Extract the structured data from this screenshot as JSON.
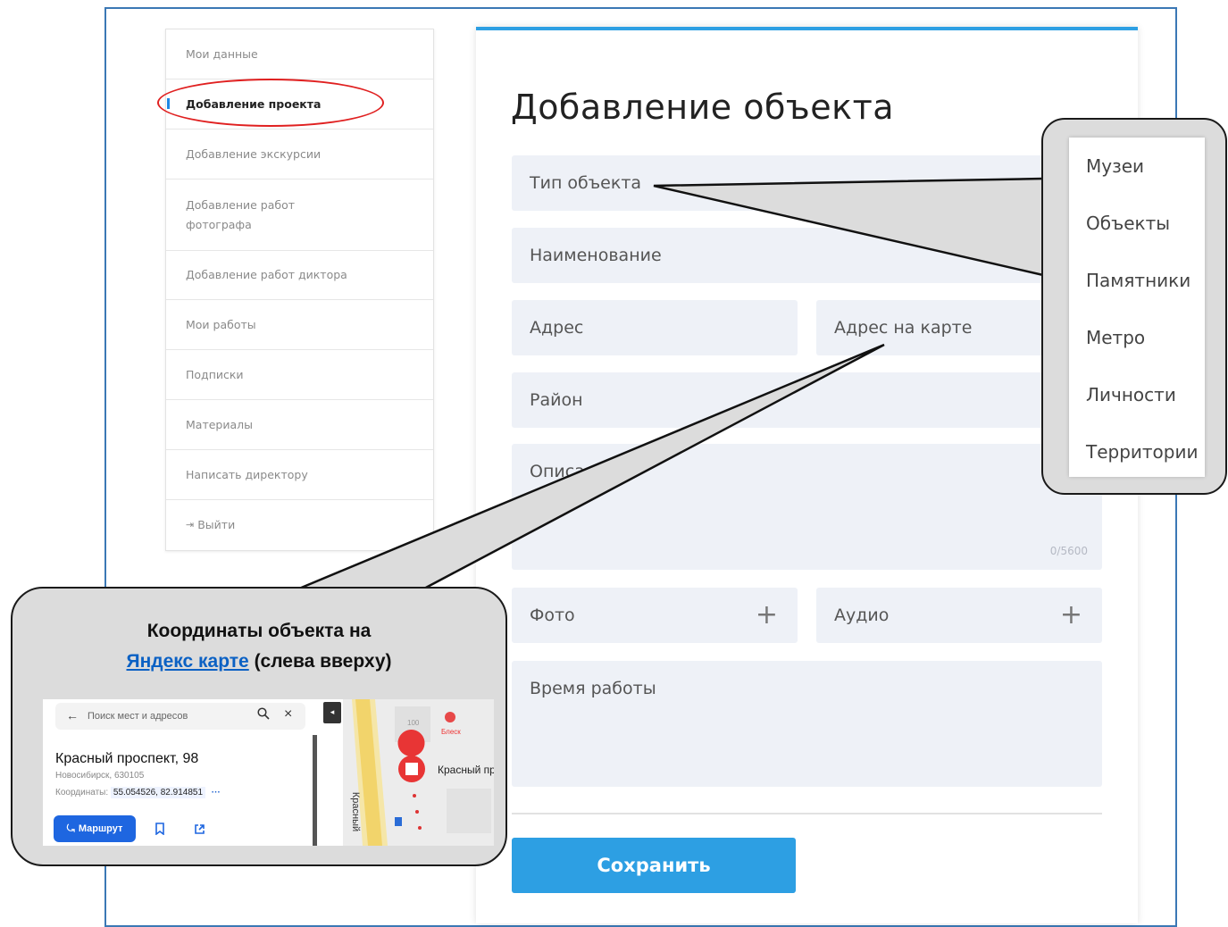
{
  "sidebar": {
    "items": [
      {
        "label": "Мои данные"
      },
      {
        "label": "Добавление проекта"
      },
      {
        "label": "Добавление экскурсии"
      },
      {
        "label": "Добавление работ фотографа"
      },
      {
        "label": "Добавление работ диктора"
      },
      {
        "label": "Мои работы"
      },
      {
        "label": "Подписки"
      },
      {
        "label": "Материалы"
      },
      {
        "label": "Написать директору"
      },
      {
        "label": "Выйти"
      }
    ]
  },
  "form": {
    "title": "Добавление объекта",
    "type_label": "Тип объекта",
    "name_label": "Наименование",
    "address_label": "Адрес",
    "map_address_label": "Адрес на карте",
    "district_label": "Район",
    "description_label": "Описание",
    "description_counter": "0/5600",
    "photo_label": "Фото",
    "audio_label": "Аудио",
    "hours_label": "Время работы",
    "save_label": "Сохранить"
  },
  "type_options": [
    "Музеи",
    "Объекты",
    "Памятники",
    "Метро",
    "Личности",
    "Территории"
  ],
  "callout": {
    "line1": "Координаты объекта на",
    "link": "Яндекс карте",
    "line2_rest": " (слева вверху)"
  },
  "yandex": {
    "search_placeholder": "Поиск мест и адресов",
    "address_title": "Красный проспект, 98",
    "city": "Новосибирск, 630105",
    "coords_label": "Координаты:",
    "coords_value": "55.054526, 82.914851",
    "route_label": "Маршрут",
    "map_label": "Красный пр",
    "map_number": "100",
    "map_shop": "Блеск",
    "map_street": "Красный"
  },
  "colors": {
    "accent": "#2d9fe3",
    "field_bg": "#eef1f7",
    "highlight_red": "#e02020",
    "frame_blue": "#3b78b5"
  }
}
